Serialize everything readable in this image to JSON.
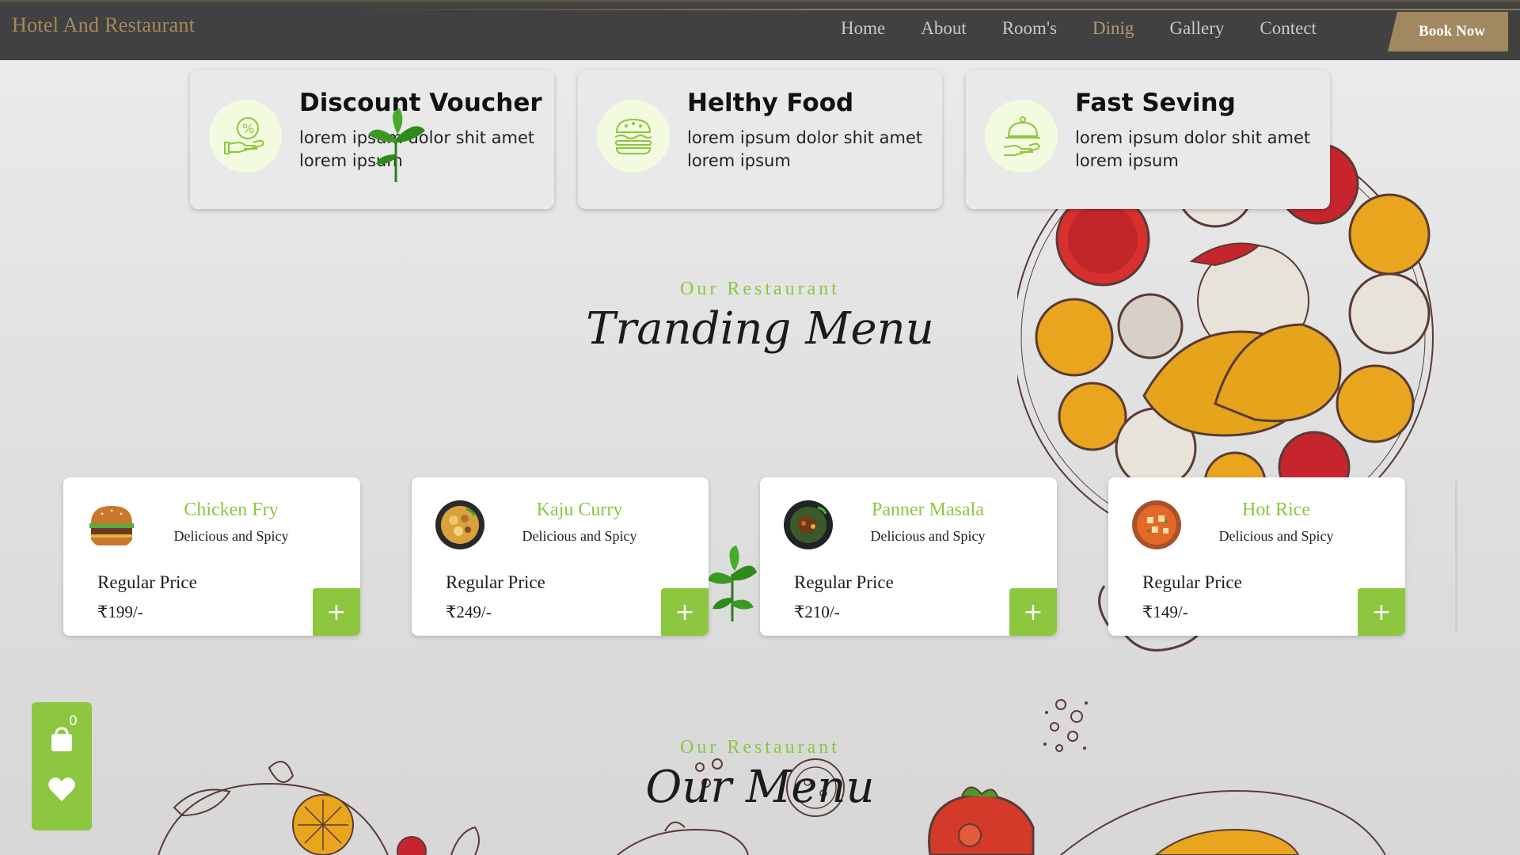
{
  "navbar": {
    "brand": "Hotel And Restaurant",
    "links": [
      "Home",
      "About",
      "Room's",
      "Dinig",
      "Gallery",
      "Contect"
    ],
    "active_link": "Dinig",
    "cta": "Book Now"
  },
  "features": [
    {
      "title": "Discount Voucher",
      "text": "lorem ipsum dolor shit amet lorem ipsum",
      "icon": "discount-hand-icon"
    },
    {
      "title": "Helthy Food",
      "text": "lorem ipsum dolor shit amet lorem ipsum",
      "icon": "burger-icon"
    },
    {
      "title": "Fast Seving",
      "text": "lorem ipsum dolor shit amet lorem ipsum",
      "icon": "serving-cloche-icon"
    }
  ],
  "trending": {
    "subtitle": "Our Restaurant",
    "title": "Tranding Menu"
  },
  "menu_items": [
    {
      "name": "Chicken Fry",
      "desc": "Delicious and Spicy",
      "price_label": "Regular Price",
      "price": "₹199/-",
      "add": "+"
    },
    {
      "name": "Kaju Curry",
      "desc": "Delicious and Spicy",
      "price_label": "Regular Price",
      "price": "₹249/-",
      "add": "+"
    },
    {
      "name": "Panner Masala",
      "desc": "Delicious and Spicy",
      "price_label": "Regular Price",
      "price": "₹210/-",
      "add": "+"
    },
    {
      "name": "Hot Rice",
      "desc": "Delicious and Spicy",
      "price_label": "Regular Price",
      "price": "₹149/-",
      "add": "+"
    }
  ],
  "our_menu": {
    "subtitle": "Our Restaurant",
    "title": "Our Menu"
  },
  "widget": {
    "cart_count": "0"
  },
  "colors": {
    "accent_green": "#8dc63f",
    "gold": "#a18861",
    "navbar_bg": "#414141"
  }
}
